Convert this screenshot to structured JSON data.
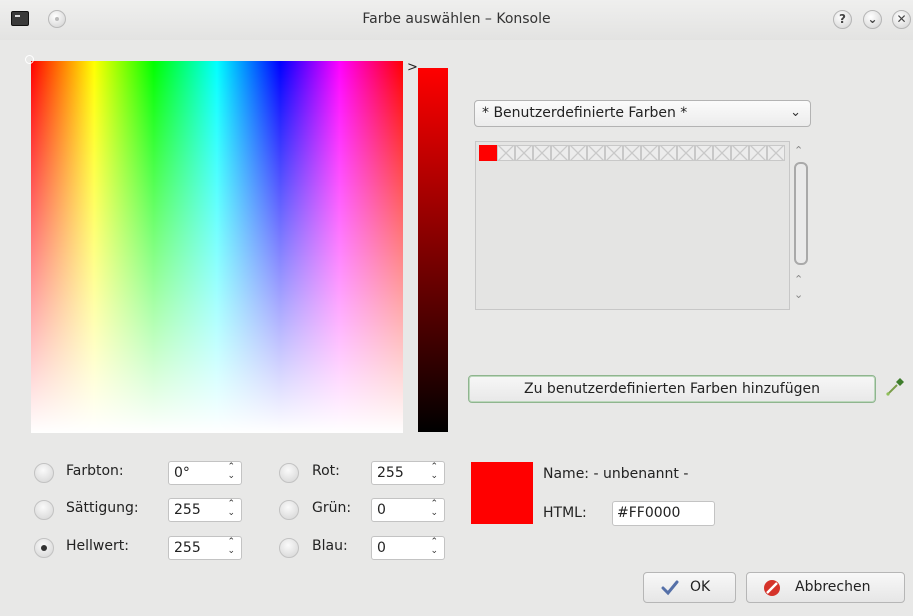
{
  "window": {
    "title": "Farbe auswählen – Konsole",
    "help_label": "?",
    "minimize_label": "⌄",
    "close_label": "✕"
  },
  "custom_colors": {
    "combo_value": "* Benutzerdefinierte Farben *",
    "swatches": [
      "#FF0000",
      "",
      "",
      "",
      "",
      "",
      "",
      "",
      "",
      "",
      "",
      "",
      "",
      "",
      "",
      "",
      ""
    ],
    "add_button_label": "Zu benutzerdefinierten Farben hinzufügen"
  },
  "controls": {
    "hue": {
      "label": "Farbton:",
      "value": "0°"
    },
    "saturation": {
      "label": "Sättigung:",
      "value": "255"
    },
    "value": {
      "label": "Hellwert:",
      "value": "255",
      "checked": true
    },
    "red": {
      "label": "Rot:",
      "value": "255"
    },
    "green": {
      "label": "Grün:",
      "value": "0"
    },
    "blue": {
      "label": "Blau:",
      "value": "0"
    }
  },
  "preview": {
    "color": "#FF0000",
    "name_text": "Name: - unbenannt -",
    "html_label": "HTML:",
    "html_value": "#FF0000"
  },
  "buttons": {
    "ok_label": "OK",
    "cancel_label": "Abbrechen"
  },
  "colors": {
    "accent_green_border": "#8fb58f",
    "selected_color": "#FF0000"
  }
}
